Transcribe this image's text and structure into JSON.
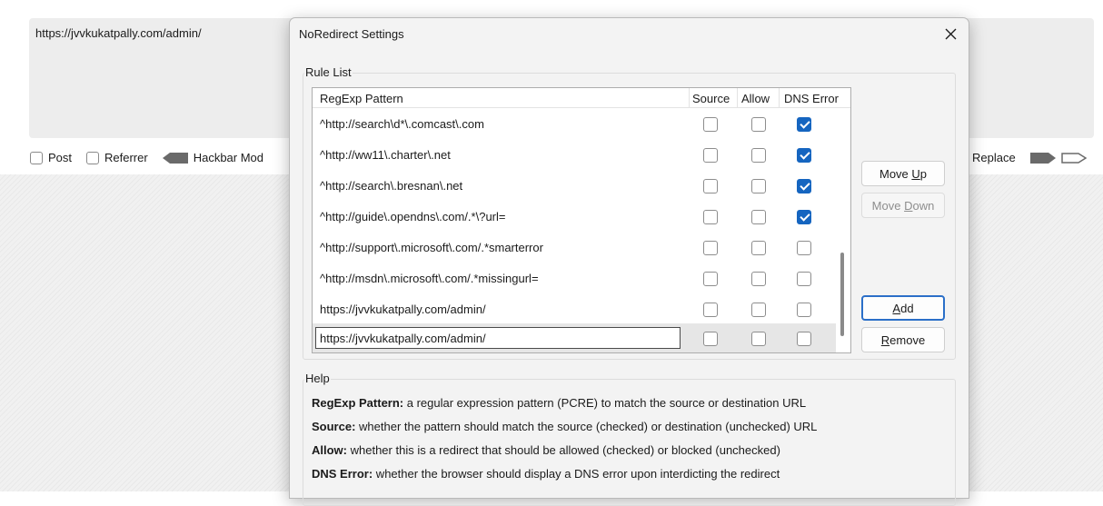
{
  "background": {
    "url_text": "https://jvvkukatpally.com/admin/",
    "toolbar": {
      "post_label": "Post",
      "referrer_label": "Referrer",
      "hackbar_label": "Hackbar Mod",
      "replace_label": "Replace"
    }
  },
  "dialog": {
    "title": "NoRedirect Settings",
    "rule_list_label": "Rule List",
    "columns": [
      "RegExp Pattern",
      "Source",
      "Allow",
      "DNS Error"
    ],
    "rows": [
      {
        "pattern": "^http://search\\d*\\.comcast\\.com",
        "source": false,
        "allow": false,
        "dns_error": true
      },
      {
        "pattern": "^http://ww11\\.charter\\.net",
        "source": false,
        "allow": false,
        "dns_error": true
      },
      {
        "pattern": "^http://search\\.bresnan\\.net",
        "source": false,
        "allow": false,
        "dns_error": true
      },
      {
        "pattern": "^http://guide\\.opendns\\.com/.*\\?url=",
        "source": false,
        "allow": false,
        "dns_error": true
      },
      {
        "pattern": "^http://support\\.microsoft\\.com/.*smarterror",
        "source": false,
        "allow": false,
        "dns_error": false
      },
      {
        "pattern": "^http://msdn\\.microsoft\\.com/.*missingurl=",
        "source": false,
        "allow": false,
        "dns_error": false
      },
      {
        "pattern": "https://jvvkukatpally.com/admin/",
        "source": false,
        "allow": false,
        "dns_error": false
      },
      {
        "pattern": "https://jvvkukatpally.com/admin/",
        "source": false,
        "allow": false,
        "dns_error": false,
        "editing": true
      }
    ],
    "buttons": {
      "move_up_pre": "Move ",
      "move_up_key": "U",
      "move_up_post": "p",
      "move_down_pre": "Move ",
      "move_down_key": "D",
      "move_down_post": "own",
      "add_key": "A",
      "add_post": "dd",
      "remove_key": "R",
      "remove_post": "emove"
    },
    "help": {
      "label": "Help",
      "lines": [
        {
          "term": "RegExp Pattern:",
          "text": " a regular expression pattern (PCRE) to match the source or destination URL"
        },
        {
          "term": "Source:",
          "text": " whether the pattern should match the source (checked) or destination (unchecked) URL"
        },
        {
          "term": "Allow:",
          "text": " whether this is a redirect that should be allowed (checked) or blocked (unchecked)"
        },
        {
          "term": "DNS Error:",
          "text": " whether the browser should display a DNS error upon interdicting the redirect"
        }
      ]
    }
  },
  "colors": {
    "accent": "#1565c0",
    "focus_border": "#2b6fc8"
  }
}
